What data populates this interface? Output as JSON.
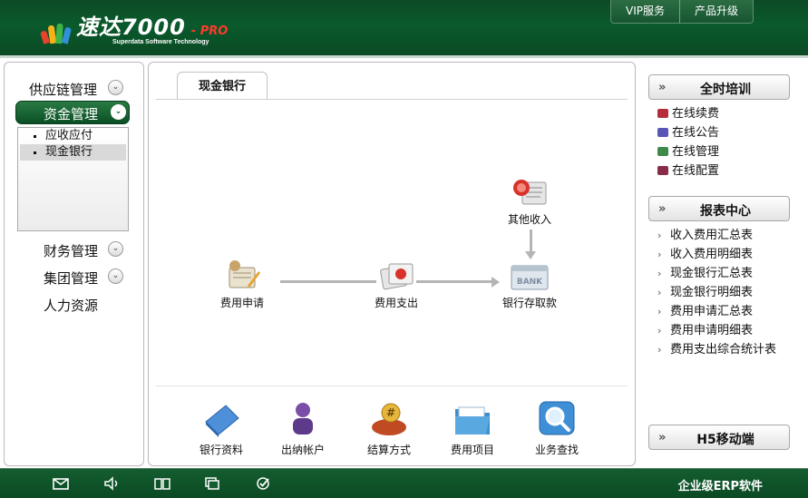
{
  "app": {
    "logo_name": "速达7000",
    "logo_pro": "- PRO",
    "logo_sub": "Superdata Software Technology"
  },
  "top_links": [
    "VIP服务",
    "产品升级"
  ],
  "sidebar": {
    "items": [
      {
        "label": "供应链管理",
        "arrow": "⌄"
      },
      {
        "label": "资金管理",
        "arrow": "⌄"
      },
      {
        "label": "财务管理",
        "arrow": "⌄"
      },
      {
        "label": "集团管理",
        "arrow": "⌄"
      },
      {
        "label": "人力资源"
      }
    ],
    "sub_items": [
      "应收应付",
      "现金银行"
    ]
  },
  "main": {
    "tab": "现金银行",
    "flow": {
      "apply": "费用申请",
      "pay": "费用支出",
      "bank": "银行存取款",
      "other_income": "其他收入",
      "bank_sign": "BANK"
    },
    "quick": [
      "银行资料",
      "出纳帐户",
      "结算方式",
      "费用项目",
      "业务查找"
    ]
  },
  "right": {
    "training_title": "全时培训",
    "training_items": [
      "在线续费",
      "在线公告",
      "在线管理",
      "在线配置"
    ],
    "report_title": "报表中心",
    "report_items": [
      "收入费用汇总表",
      "收入费用明细表",
      "现金银行汇总表",
      "现金银行明细表",
      "费用申请汇总表",
      "费用申请明细表",
      "费用支出综合统计表"
    ],
    "mobile_title": "H5移动端",
    "chevron": "»"
  },
  "footer": {
    "text": "企业级ERP软件",
    "icons": [
      "mail-icon",
      "speaker-icon",
      "book-icon",
      "window-icon",
      "check-icon"
    ]
  },
  "colors": {
    "header_green": "#0b4a24",
    "active_green": "#0a5026",
    "logo_pro_red": "#ff3a2a"
  }
}
